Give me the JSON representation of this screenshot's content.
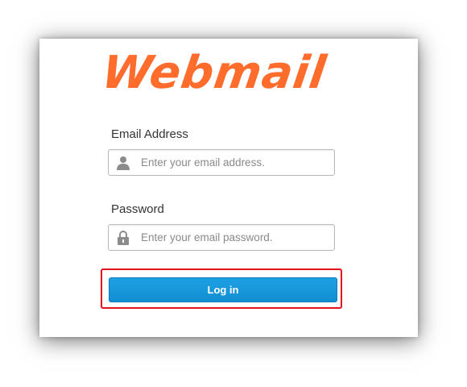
{
  "logo": {
    "text": "Webmail",
    "color": "#ff6c2c"
  },
  "email": {
    "label": "Email Address",
    "placeholder": "Enter your email address.",
    "value": "",
    "icon": "user-icon"
  },
  "password": {
    "label": "Password",
    "placeholder": "Enter your email password.",
    "value": "",
    "icon": "lock-icon"
  },
  "login_button": {
    "label": "Log in",
    "color": "#1a9ce0"
  },
  "highlight_color": "#e3121d"
}
